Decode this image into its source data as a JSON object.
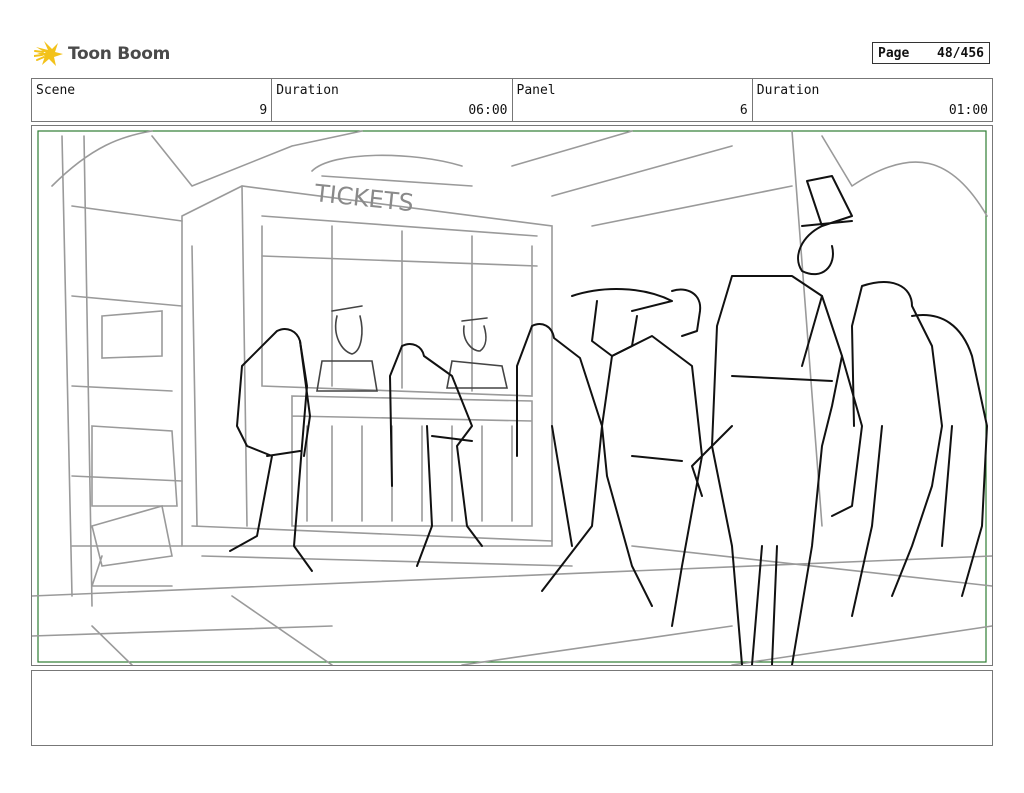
{
  "brand": {
    "name": "Toon Boom",
    "icon": "toon-boom-star-icon",
    "accent": "#f3c21a"
  },
  "page": {
    "label": "Page",
    "number": "48/456"
  },
  "header": [
    {
      "label": "Scene",
      "value": "9"
    },
    {
      "label": "Duration",
      "value": "06:00"
    },
    {
      "label": "Panel",
      "value": "6"
    },
    {
      "label": "Duration",
      "value": "01:00"
    }
  ],
  "panel": {
    "sign_text": "TICKETS",
    "frame_color": "#2e7d32"
  },
  "notes": {
    "text": ""
  }
}
